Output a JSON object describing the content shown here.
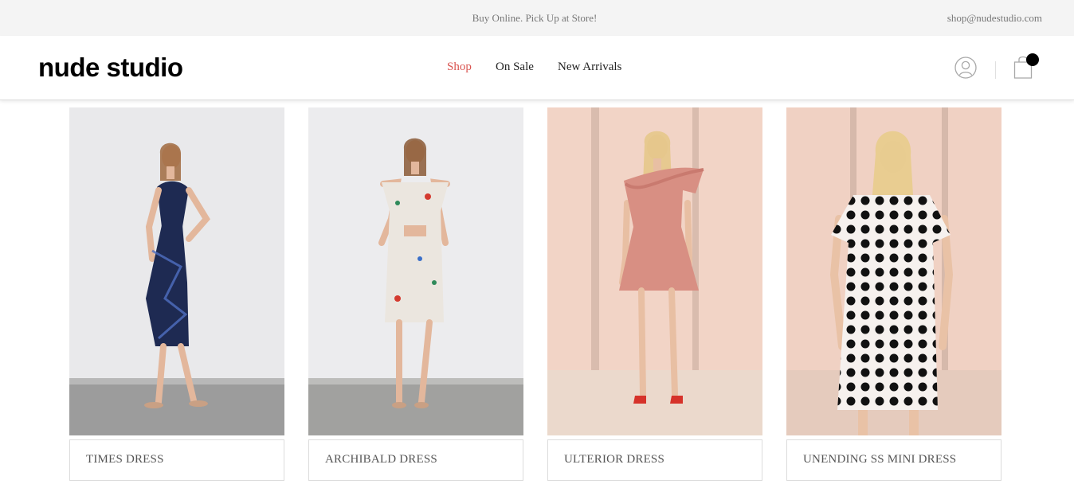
{
  "topbar": {
    "promo": "Buy Online. Pick Up at Store!",
    "email": "shop@nudestudio.com"
  },
  "header": {
    "logo": "nude studio",
    "nav": [
      {
        "label": "Shop",
        "active": true
      },
      {
        "label": "On Sale",
        "active": false
      },
      {
        "label": "New Arrivals",
        "active": false
      }
    ],
    "icons": {
      "account": "user-icon",
      "cart": "shopping-bag-icon"
    },
    "accent_color": "#d9534f"
  },
  "products": [
    {
      "title": "TIMES DRESS",
      "image": "navy lace dress",
      "bg": "#e8e8ea",
      "floor": "#9a9a9a",
      "dress": "#1e2a52"
    },
    {
      "title": "ARCHIBALD DRESS",
      "image": "white floral dress",
      "bg": "#ececee",
      "floor": "#a0a09e",
      "dress": "#ebe6df"
    },
    {
      "title": "ULTERIOR DRESS",
      "image": "pink ruffle dress",
      "bg": "#f1d2c3",
      "floor": "#ead6c8",
      "dress": "#d88f83"
    },
    {
      "title": "UNENDING SS MINI DRESS",
      "image": "polka dot dress",
      "bg": "#f0d0c2",
      "floor": "#e6cbbc",
      "dress": "#f6f1ee"
    }
  ]
}
